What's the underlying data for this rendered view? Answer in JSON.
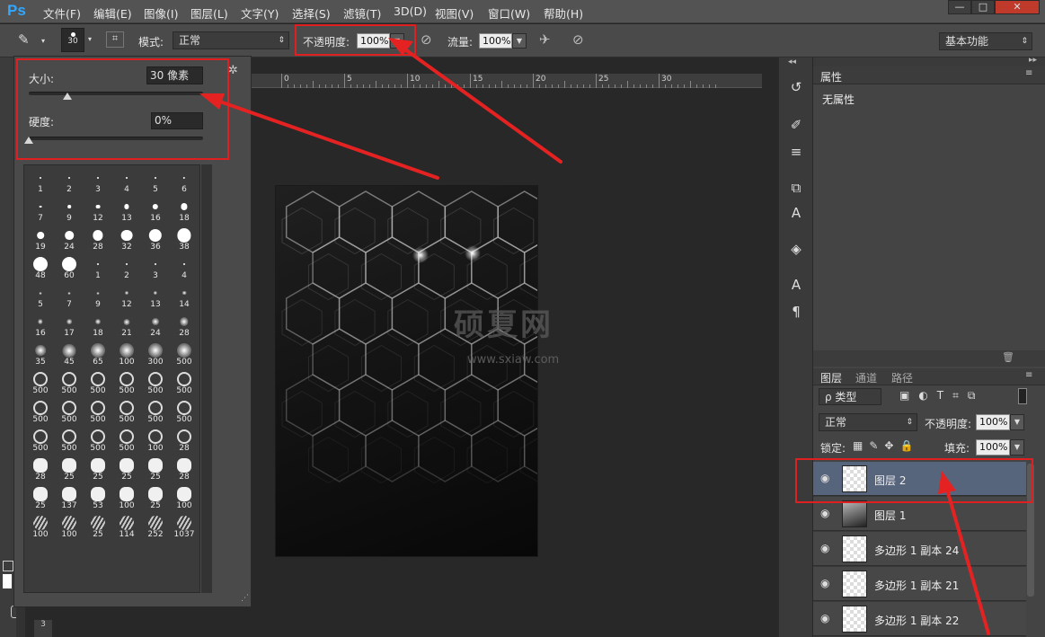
{
  "app": {
    "logo": "Ps"
  },
  "menu": [
    "文件(F)",
    "编辑(E)",
    "图像(I)",
    "图层(L)",
    "文字(Y)",
    "选择(S)",
    "滤镜(T)",
    "3D(D)",
    "视图(V)",
    "窗口(W)",
    "帮助(H)"
  ],
  "options": {
    "brush_size": "30",
    "mode_label": "模式:",
    "mode_value": "正常",
    "opacity_label": "不透明度:",
    "opacity_value": "100%",
    "flow_label": "流量:",
    "flow_value": "100%",
    "workspace": "基本功能"
  },
  "brush_popup": {
    "size_label": "大小:",
    "size_value": "30 像素",
    "size_level": 0.07,
    "hardness_label": "硬度:",
    "hardness_value": "0%",
    "hardness_level": 0.0,
    "presets": [
      "1",
      "2",
      "3",
      "4",
      "5",
      "6",
      "7",
      "9",
      "12",
      "13",
      "16",
      "18",
      "19",
      "24",
      "28",
      "32",
      "36",
      "38",
      "48",
      "60",
      "1",
      "2",
      "3",
      "4",
      "5",
      "7",
      "9",
      "12",
      "13",
      "14",
      "16",
      "17",
      "18",
      "21",
      "24",
      "28",
      "35",
      "45",
      "65",
      "100",
      "300",
      "500",
      "500",
      "500",
      "500",
      "500",
      "500",
      "500",
      "500",
      "500",
      "500",
      "500",
      "500",
      "500",
      "500",
      "500",
      "500",
      "500",
      "100",
      "28",
      "28",
      "25",
      "25",
      "25",
      "25",
      "28",
      "25",
      "137",
      "53",
      "100",
      "25",
      "100",
      "100",
      "100",
      "25",
      "114",
      "252",
      "1037"
    ]
  },
  "ruler": {
    "labels": [
      "0",
      "5",
      "10",
      "15",
      "20",
      "25",
      "30"
    ]
  },
  "canvas": {
    "watermark": "硕夏网",
    "watermark_sub": "www.sxiaw.com"
  },
  "properties": {
    "tab": "属性",
    "content": "无属性"
  },
  "layers_panel": {
    "tabs": [
      "图层",
      "通道",
      "路径"
    ],
    "filter": "ρ 类型",
    "blend_mode": "正常",
    "opacity_label": "不透明度:",
    "opacity_value": "100%",
    "lock_label": "锁定:",
    "fill_label": "填充:",
    "fill_value": "100%",
    "layers": [
      {
        "name": "图层 2",
        "selected": true
      },
      {
        "name": "图层 1",
        "selected": false
      },
      {
        "name": "多边形 1 副本 24",
        "selected": false
      },
      {
        "name": "多边形 1 副本 21",
        "selected": false
      },
      {
        "name": "多边形 1 副本 22",
        "selected": false
      }
    ]
  },
  "colors": {
    "highlight": "#e02020",
    "selected_layer": "#56647c",
    "accent": "#31a8ff"
  }
}
